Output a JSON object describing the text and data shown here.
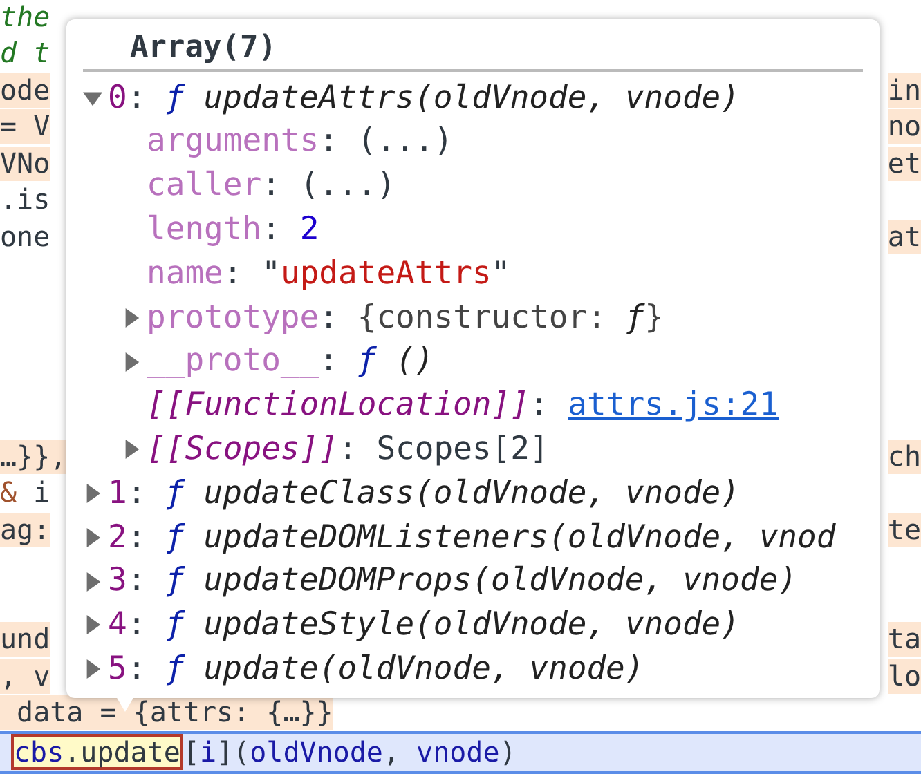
{
  "code_blocks": [
    [
      {
        "left": [
          {
            "t": "the",
            "kind": "comment"
          }
        ],
        "left_highlight": false
      },
      {
        "left": [
          {
            "t": "d t",
            "kind": "comment"
          }
        ],
        "left_highlight": false
      },
      {
        "left": [
          {
            "t": "ode",
            "kind": "plain"
          }
        ],
        "left_highlight": true,
        "right": "in",
        "right_highlight": true
      },
      {
        "left": [
          {
            "t": "= V",
            "kind": "plain"
          }
        ],
        "left_highlight": true,
        "right": "no",
        "right_highlight": true
      },
      {
        "left": [
          {
            "t": "VNo",
            "kind": "plain"
          }
        ],
        "left_highlight": true,
        "right": "et",
        "right_highlight": true
      },
      {
        "left": [
          {
            "t": ".is",
            "kind": "plain"
          }
        ],
        "left_highlight": false
      },
      {
        "left": [
          {
            "t": "one",
            "kind": "plain"
          }
        ],
        "left_highlight": false,
        "right": "at",
        "right_highlight": true
      }
    ],
    [
      {
        "left": [
          {
            "t": "…}},",
            "kind": "plain"
          }
        ],
        "left_highlight": true,
        "right": "ch",
        "right_highlight": true
      },
      {
        "left": [
          {
            "t": "& ",
            "kind": "operator"
          },
          {
            "t": "i",
            "kind": "plain"
          }
        ],
        "left_highlight": false
      },
      {
        "left": [
          {
            "t": "ag:",
            "kind": "plain"
          }
        ],
        "left_highlight": true,
        "right": "te",
        "right_highlight": true
      }
    ],
    [
      {
        "left": [
          {
            "t": "und",
            "kind": "plain"
          }
        ],
        "left_highlight": true,
        "right": "ta",
        "right_highlight": true
      },
      {
        "left": [
          {
            "t": ", v",
            "kind": "plain"
          }
        ],
        "left_highlight": true,
        "right": "lo",
        "right_highlight": true
      },
      {
        "left": [
          {
            "t": " data = ",
            "kind": "plain"
          },
          {
            "t": "{attrs: {…}}",
            "kind": "plain"
          }
        ],
        "left_highlight": true
      },
      {
        "selected": true,
        "hover": [
          {
            "t": "cbs",
            "kind": "variable"
          },
          {
            "t": ".",
            "kind": "plain"
          },
          {
            "t": "update",
            "kind": "plain"
          }
        ],
        "left": [
          {
            "t": "[",
            "kind": "plain"
          },
          {
            "t": "i",
            "kind": "variable"
          },
          {
            "t": "](",
            "kind": "plain"
          },
          {
            "t": "oldVnode",
            "kind": "variable"
          },
          {
            "t": ", ",
            "kind": "plain"
          },
          {
            "t": "vnode",
            "kind": "variable"
          },
          {
            "t": ")",
            "kind": "plain"
          }
        ]
      }
    ]
  ],
  "popover": {
    "title": "Array(7)",
    "items": [
      {
        "index": "0",
        "separator": ":",
        "f": "ƒ",
        "signature": "updateAttrs(oldVnode, vnode)",
        "expanded": true,
        "children": [
          {
            "key": "arguments",
            "kind": "property",
            "value": [
              {
                "t": ": ",
                "kind": "plain"
              },
              {
                "t": "(...)",
                "kind": "plain"
              }
            ]
          },
          {
            "key": "caller",
            "kind": "property",
            "value": [
              {
                "t": ": ",
                "kind": "plain"
              },
              {
                "t": "(...)",
                "kind": "plain"
              }
            ]
          },
          {
            "key": "length",
            "kind": "property",
            "value": [
              {
                "t": ": ",
                "kind": "plain"
              },
              {
                "t": "2",
                "kind": "number"
              }
            ]
          },
          {
            "key": "name",
            "kind": "property",
            "value": [
              {
                "t": ": ",
                "kind": "plain"
              },
              {
                "t": "\"",
                "kind": "plain"
              },
              {
                "t": "updateAttrs",
                "kind": "string"
              },
              {
                "t": "\"",
                "kind": "plain"
              }
            ]
          },
          {
            "key": "prototype",
            "kind": "property",
            "expanded": false,
            "value": [
              {
                "t": ": ",
                "kind": "plain"
              },
              {
                "t": "{constructor: ",
                "kind": "gray"
              },
              {
                "t": "ƒ",
                "kind": "italic"
              },
              {
                "t": "}",
                "kind": "gray"
              }
            ]
          },
          {
            "key": "__proto__",
            "kind": "property",
            "expanded": false,
            "value": [
              {
                "t": ": ",
                "kind": "plain"
              },
              {
                "t": "ƒ",
                "kind": "keyword"
              },
              {
                "t": " ()",
                "kind": "italic"
              }
            ]
          },
          {
            "key": "[[FunctionLocation]]",
            "kind": "internal",
            "value": [
              {
                "t": ": ",
                "kind": "plain"
              },
              {
                "t": "attrs.js:21",
                "kind": "link"
              }
            ]
          },
          {
            "key": "[[Scopes]]",
            "kind": "internal",
            "expanded": false,
            "value": [
              {
                "t": ": ",
                "kind": "plain"
              },
              {
                "t": "Scopes[2]",
                "kind": "plain"
              }
            ]
          }
        ]
      },
      {
        "index": "1",
        "separator": ":",
        "f": "ƒ",
        "signature": "updateClass(oldVnode, vnode)",
        "expanded": false
      },
      {
        "index": "2",
        "separator": ":",
        "f": "ƒ",
        "signature": "updateDOMListeners(oldVnode, vnod",
        "expanded": false
      },
      {
        "index": "3",
        "separator": ":",
        "f": "ƒ",
        "signature": "updateDOMProps(oldVnode, vnode)",
        "expanded": false
      },
      {
        "index": "4",
        "separator": ":",
        "f": "ƒ",
        "signature": "updateStyle(oldVnode, vnode)",
        "expanded": false
      },
      {
        "index": "5",
        "separator": ":",
        "f": "ƒ",
        "signature": "update(oldVnode, vnode)",
        "expanded": false
      }
    ]
  }
}
